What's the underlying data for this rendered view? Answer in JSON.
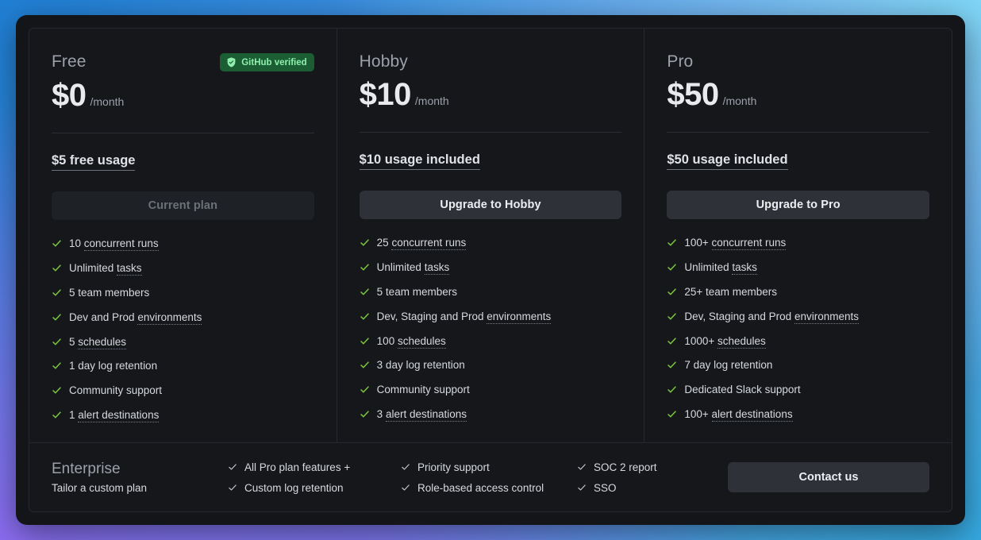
{
  "colors": {
    "panel_bg": "#15171b",
    "border": "#25282e",
    "check_green": "#7bc43c",
    "badge_bg": "#1b5e33",
    "badge_text": "#8ff0ae",
    "cta_active_bg": "#2e3238",
    "cta_disabled_bg": "#1e2126",
    "text_primary": "#d6d9de",
    "text_muted": "#9ca1aa"
  },
  "plans": [
    {
      "name": "Free",
      "badge": {
        "label": "GitHub verified",
        "icon": "shield-check-icon"
      },
      "price": "$0",
      "period": "/month",
      "usage_link": "$5 free usage",
      "cta": {
        "label": "Current plan",
        "state": "disabled"
      },
      "features": [
        {
          "prefix": "10 ",
          "hint": "concurrent runs"
        },
        {
          "prefix": "Unlimited ",
          "hint": "tasks"
        },
        {
          "prefix": "5 team members",
          "hint": ""
        },
        {
          "prefix": "Dev and Prod ",
          "hint": "environments"
        },
        {
          "prefix": "5 ",
          "hint": "schedules"
        },
        {
          "prefix": "1 day log retention",
          "hint": ""
        },
        {
          "prefix": "Community support",
          "hint": ""
        },
        {
          "prefix": "1 ",
          "hint": "alert destinations"
        }
      ]
    },
    {
      "name": "Hobby",
      "badge": null,
      "price": "$10",
      "period": "/month",
      "usage_link": "$10 usage included",
      "cta": {
        "label": "Upgrade to Hobby",
        "state": "active"
      },
      "features": [
        {
          "prefix": "25 ",
          "hint": "concurrent runs"
        },
        {
          "prefix": "Unlimited ",
          "hint": "tasks"
        },
        {
          "prefix": "5 team members",
          "hint": ""
        },
        {
          "prefix": "Dev, Staging and Prod ",
          "hint": "environments"
        },
        {
          "prefix": "100 ",
          "hint": "schedules"
        },
        {
          "prefix": "3 day log retention",
          "hint": ""
        },
        {
          "prefix": "Community support",
          "hint": ""
        },
        {
          "prefix": "3 ",
          "hint": "alert destinations"
        }
      ]
    },
    {
      "name": "Pro",
      "badge": null,
      "price": "$50",
      "period": "/month",
      "usage_link": "$50 usage included",
      "cta": {
        "label": "Upgrade to Pro",
        "state": "active"
      },
      "features": [
        {
          "prefix": "100+ ",
          "hint": "concurrent runs"
        },
        {
          "prefix": "Unlimited ",
          "hint": "tasks"
        },
        {
          "prefix": "25+ team members",
          "hint": ""
        },
        {
          "prefix": "Dev, Staging and Prod ",
          "hint": "environments"
        },
        {
          "prefix": "1000+ ",
          "hint": "schedules"
        },
        {
          "prefix": "7 day log retention",
          "hint": ""
        },
        {
          "prefix": "Dedicated Slack support",
          "hint": ""
        },
        {
          "prefix": "100+ ",
          "hint": "alert destinations"
        }
      ]
    }
  ],
  "enterprise": {
    "title": "Enterprise",
    "subtitle": "Tailor a custom plan",
    "columns": [
      [
        "All Pro plan features +",
        "Custom log retention"
      ],
      [
        "Priority support",
        "Role-based access control"
      ],
      [
        "SOC 2 report",
        "SSO"
      ]
    ],
    "cta": "Contact us"
  }
}
